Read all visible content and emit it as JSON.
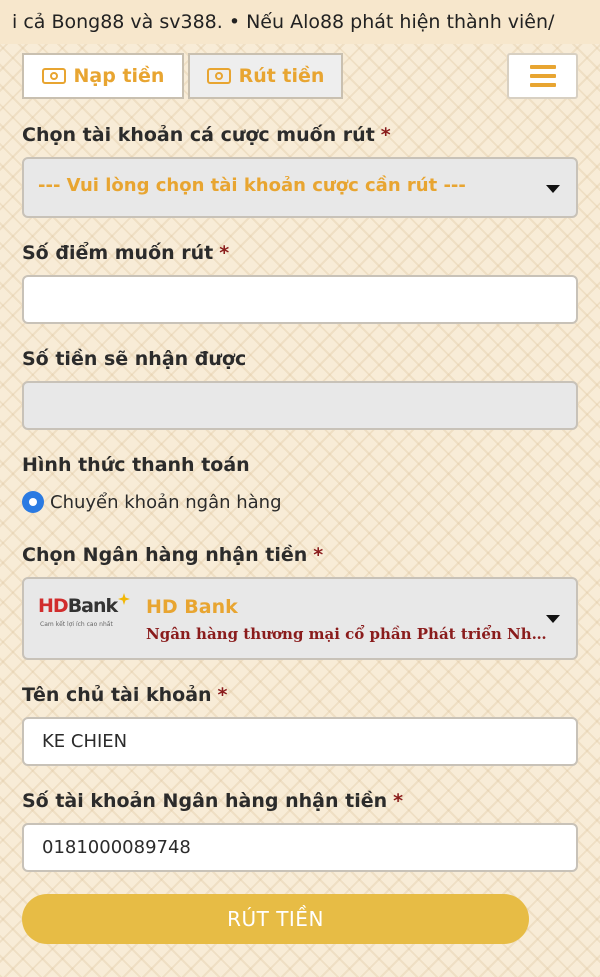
{
  "marquee": {
    "text": "i cả Bong88 và sv388.       • Nếu Alo88 phát hiện thành viên/"
  },
  "tabs": {
    "deposit": "Nạp tiền",
    "withdraw": "Rút tiền"
  },
  "form": {
    "account": {
      "label": "Chọn tài khoản cá cược muốn rút",
      "required": "*",
      "placeholder": "--- Vui lòng chọn tài khoản cược cần rút ---"
    },
    "points": {
      "label": "Số điểm muốn rút",
      "required": "*",
      "value": ""
    },
    "amount": {
      "label": "Số tiền sẽ nhận được",
      "value": ""
    },
    "payment": {
      "label": "Hình thức thanh toán",
      "option": "Chuyển khoản ngân hàng"
    },
    "bank": {
      "label": "Chọn Ngân hàng nhận tiền",
      "required": "*",
      "logo_red": "HD",
      "logo_dark": "Bank",
      "logo_slogan": "Cam kết lợi ích cao nhất",
      "name": "HD Bank",
      "full_name": "Ngân hàng thương mại cổ phần Phát triển Nhà TP HCM"
    },
    "holder": {
      "label": "Tên chủ tài khoản",
      "required": "*",
      "value": "KE CHIEN"
    },
    "account_number": {
      "label": "Số tài khoản Ngân hàng nhận tiền",
      "required": "*",
      "value": "0181000089748"
    },
    "submit": "RÚT TIỀN"
  },
  "colors": {
    "accent": "#e8a531",
    "required": "#8a1c1c",
    "button": "#e7bc45",
    "radio": "#2a7ae2"
  }
}
